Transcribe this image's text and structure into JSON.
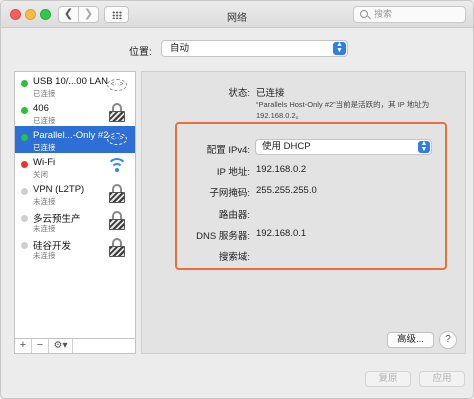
{
  "window": {
    "title": "网络",
    "search_placeholder": "搜索",
    "back_glyph": "❮",
    "forward_glyph": "❯"
  },
  "location": {
    "label": "位置:",
    "value": "自动"
  },
  "services": [
    {
      "name": "USB 10/...00 LAN",
      "status": "已连接",
      "dot": "green",
      "icon": "arrows-icon"
    },
    {
      "name": "406",
      "status": "已连接",
      "dot": "green",
      "icon": "lock-icon"
    },
    {
      "name": "Parallel...-Only #2",
      "status": "已连接",
      "dot": "green",
      "icon": "arrows-icon",
      "selected": true
    },
    {
      "name": "Wi-Fi",
      "status": "关闭",
      "dot": "red",
      "icon": "wifi-icon"
    },
    {
      "name": "VPN (L2TP)",
      "status": "未连接",
      "dot": "gray",
      "icon": "lock-icon"
    },
    {
      "name": "多云预生产",
      "status": "未连接",
      "dot": "gray",
      "icon": "lock-icon"
    },
    {
      "name": "硅谷开发",
      "status": "未连接",
      "dot": "gray",
      "icon": "lock-icon"
    }
  ],
  "sidebar_toolbar": {
    "add": "+",
    "remove": "−",
    "gear": "⚙▾"
  },
  "details": {
    "status_label": "状态:",
    "status_value": "已连接",
    "status_note": "“Parallels Host-Only #2”当前是活跃的，其 IP 地址为 192.168.0.2。",
    "ipv4_label": "配置 IPv4:",
    "ipv4_value": "使用 DHCP",
    "ip_label": "IP 地址:",
    "ip_value": "192.168.0.2",
    "mask_label": "子网掩码:",
    "mask_value": "255.255.255.0",
    "router_label": "路由器:",
    "router_value": "",
    "dns_label": "DNS 服务器:",
    "dns_value": "192.168.0.1",
    "search_domain_label": "搜索域:",
    "search_domain_value": ""
  },
  "buttons": {
    "advanced": "高级...",
    "help": "?",
    "revert": "复原",
    "apply": "应用"
  },
  "colors": {
    "selection": "#2d6fd6",
    "highlight_border": "#f26b3a",
    "connected": "#2bc13a",
    "off": "#e8342c",
    "not_connected": "#cfcfcf"
  }
}
